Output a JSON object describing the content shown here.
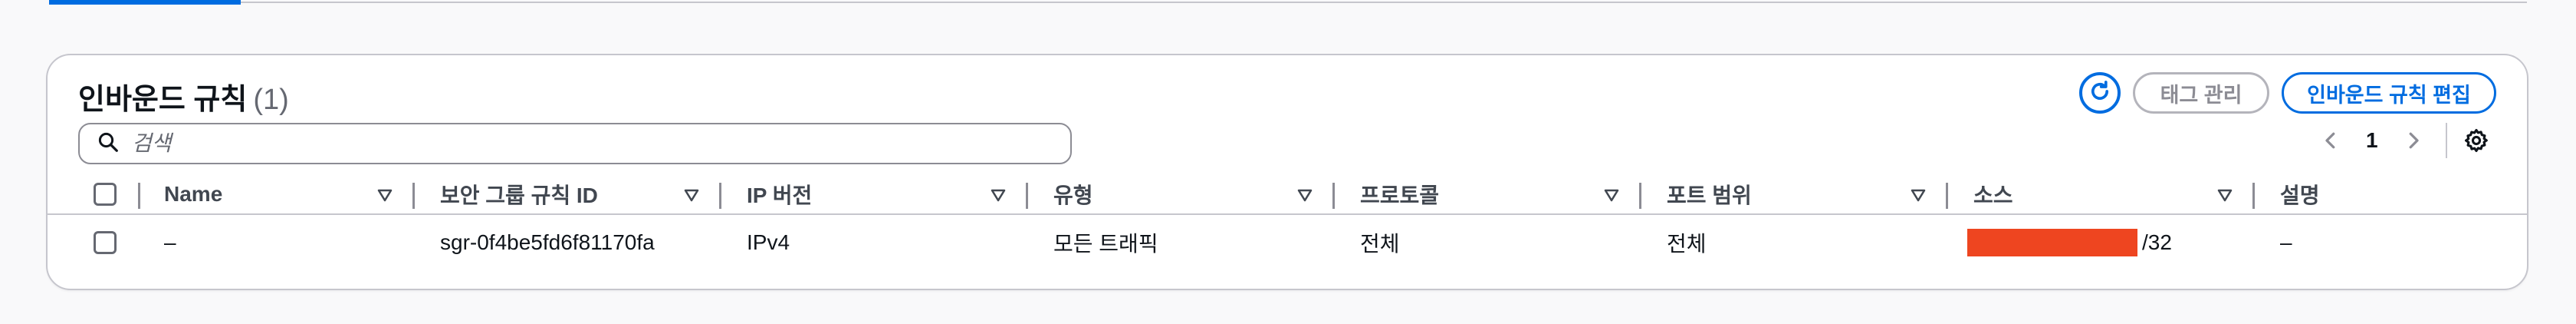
{
  "panel": {
    "title": "인바운드 규칙",
    "count": "(1)",
    "search_placeholder": "검색"
  },
  "actions": {
    "refresh_icon": "refresh-icon",
    "manage_tags_label": "태그 관리",
    "edit_rules_label": "인바운드 규칙 편집"
  },
  "pagination": {
    "current_page": "1",
    "prev_icon": "chevron-left-icon",
    "next_icon": "chevron-right-icon",
    "settings_icon": "gear-icon"
  },
  "table": {
    "columns": [
      "Name",
      "보안 그룹 규칙 ID",
      "IP 버전",
      "유형",
      "프로토콜",
      "포트 범위",
      "소스",
      "설명"
    ],
    "rows": [
      {
        "name": "–",
        "rule_id": "sgr-0f4be5fd6f81170fa",
        "ip_version": "IPv4",
        "type": "모든 트래픽",
        "protocol": "전체",
        "port_range": "전체",
        "source_suffix": "/32",
        "description": "–"
      }
    ]
  },
  "colors": {
    "accent": "#006ce0",
    "redaction": "#ee4520",
    "border": "#c6c6cd"
  }
}
